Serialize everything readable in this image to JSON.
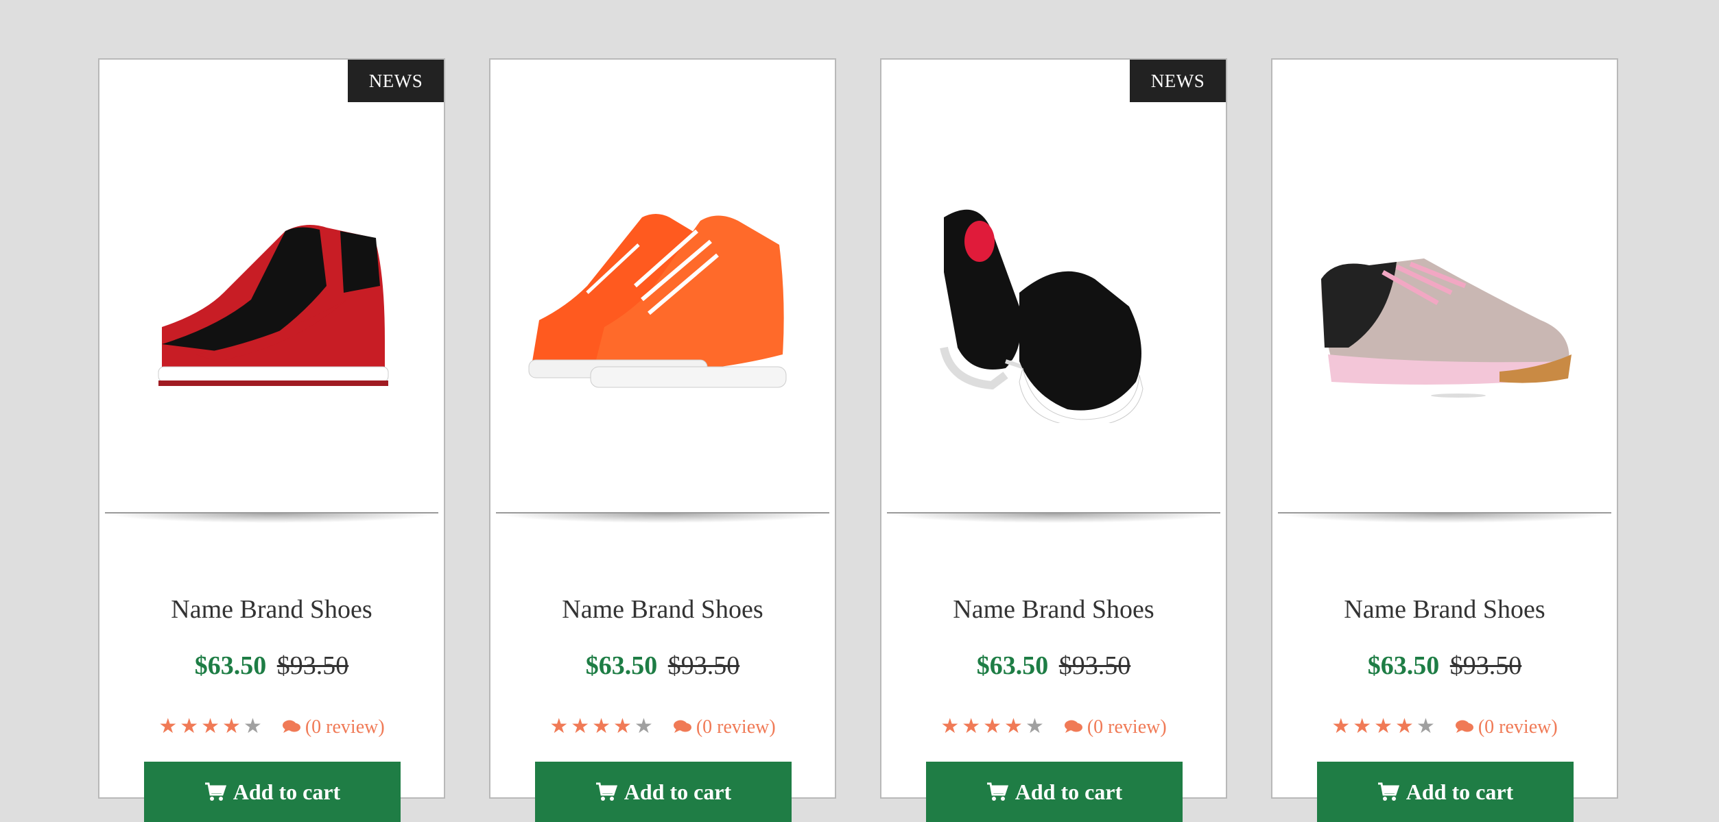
{
  "products": [
    {
      "badge": "NEWS",
      "name": "Name Brand Shoes",
      "price": "$63.50",
      "old_price": "$93.50",
      "review": "(0 review)",
      "cart_label": "Add to cart",
      "image_icon": "sneaker-red-black-icon",
      "rating": 4,
      "rating_max": 5
    },
    {
      "badge": "",
      "name": "Name Brand Shoes",
      "price": "$63.50",
      "old_price": "$93.50",
      "review": "(0 review)",
      "cart_label": "Add to cart",
      "image_icon": "sneaker-orange-icon",
      "rating": 4,
      "rating_max": 5
    },
    {
      "badge": "NEWS",
      "name": "Name Brand Shoes",
      "price": "$63.50",
      "old_price": "$93.50",
      "review": "(0 review)",
      "cart_label": "Add to cart",
      "image_icon": "sneaker-black-white-icon",
      "rating": 4,
      "rating_max": 5
    },
    {
      "badge": "",
      "name": "Name Brand Shoes",
      "price": "$63.50",
      "old_price": "$93.50",
      "review": "(0 review)",
      "cart_label": "Add to cart",
      "image_icon": "sneaker-pink-runner-icon",
      "rating": 4,
      "rating_max": 5
    }
  ],
  "colors": {
    "accent_green": "#1f7d45",
    "star_orange": "#f07a56",
    "badge_dark": "#222222"
  }
}
